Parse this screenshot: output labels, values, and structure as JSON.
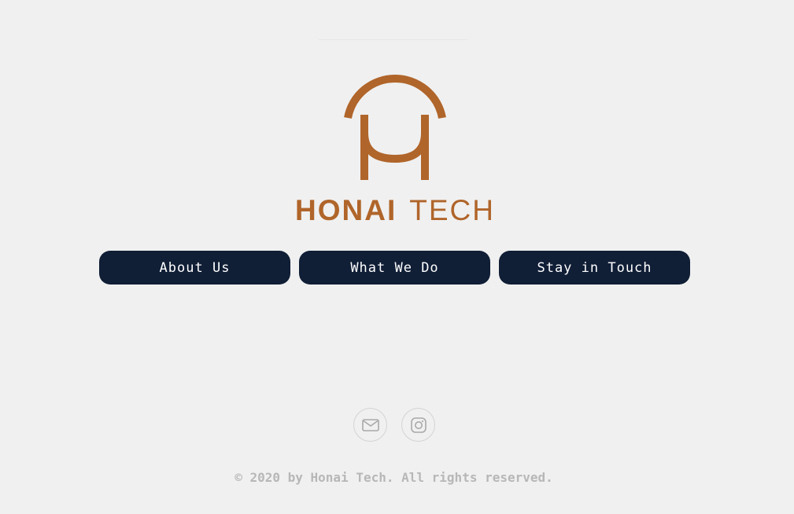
{
  "brand": {
    "name_bold": "HONAI",
    "name_light": "TECH",
    "color": "#b0652a",
    "logo_icon": "honai-arch-mu-logo"
  },
  "nav": {
    "items": [
      {
        "label": "About Us"
      },
      {
        "label": "What We Do"
      },
      {
        "label": "Stay in Touch"
      }
    ],
    "button_color": "#101e36",
    "text_color": "#ffffff"
  },
  "social": {
    "items": [
      {
        "icon": "mail-icon"
      },
      {
        "icon": "instagram-icon"
      }
    ]
  },
  "footer": {
    "copyright": "© 2020 by Honai Tech. All rights reserved."
  },
  "colors": {
    "background": "#f0f0f0",
    "muted_text": "#b7b7b7"
  }
}
